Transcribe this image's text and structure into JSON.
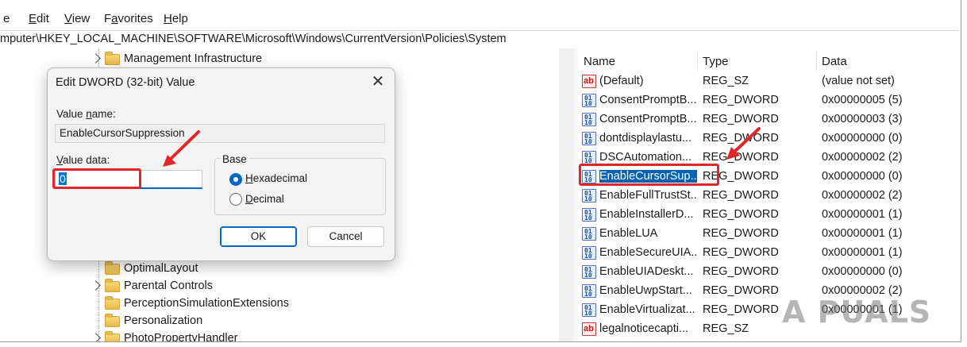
{
  "menu": {
    "items": [
      "e",
      "Edit",
      "View",
      "Favorites",
      "Help"
    ],
    "underlined": [
      "",
      "E",
      "V",
      "a",
      "H"
    ]
  },
  "address": "mputer\\HKEY_LOCAL_MACHINE\\SOFTWARE\\Microsoft\\Windows\\CurrentVersion\\Policies\\System",
  "tree": {
    "top_node": "Management Infrastructure",
    "nodes": [
      "OptimalLayout",
      "Parental Controls",
      "PerceptionSimulationExtensions",
      "Personalization",
      "PhotoPropertyHandler"
    ]
  },
  "list": {
    "columns": [
      "Name",
      "Type",
      "Data"
    ],
    "rows": [
      {
        "icon": "string-value-icon",
        "name": "(Default)",
        "type": "REG_SZ",
        "data": "(value not set)"
      },
      {
        "icon": "dword-value-icon",
        "name": "ConsentPromptB...",
        "type": "REG_DWORD",
        "data": "0x00000005 (5)"
      },
      {
        "icon": "dword-value-icon",
        "name": "ConsentPromptB...",
        "type": "REG_DWORD",
        "data": "0x00000003 (3)"
      },
      {
        "icon": "dword-value-icon",
        "name": "dontdisplaylastu...",
        "type": "REG_DWORD",
        "data": "0x00000000 (0)"
      },
      {
        "icon": "dword-value-icon",
        "name": "DSCAutomation...",
        "type": "REG_DWORD",
        "data": "0x00000002 (2)"
      },
      {
        "icon": "dword-value-icon",
        "name": "EnableCursorSup...",
        "type": "REG_DWORD",
        "data": "0x00000000 (0)",
        "selected": true
      },
      {
        "icon": "dword-value-icon",
        "name": "EnableFullTrustSt...",
        "type": "REG_DWORD",
        "data": "0x00000002 (2)"
      },
      {
        "icon": "dword-value-icon",
        "name": "EnableInstallerD...",
        "type": "REG_DWORD",
        "data": "0x00000001 (1)"
      },
      {
        "icon": "dword-value-icon",
        "name": "EnableLUA",
        "type": "REG_DWORD",
        "data": "0x00000001 (1)"
      },
      {
        "icon": "dword-value-icon",
        "name": "EnableSecureUIA...",
        "type": "REG_DWORD",
        "data": "0x00000001 (1)"
      },
      {
        "icon": "dword-value-icon",
        "name": "EnableUIADeskt...",
        "type": "REG_DWORD",
        "data": "0x00000000 (0)"
      },
      {
        "icon": "dword-value-icon",
        "name": "EnableUwpStart...",
        "type": "REG_DWORD",
        "data": "0x00000002 (2)"
      },
      {
        "icon": "dword-value-icon",
        "name": "EnableVirtualizat...",
        "type": "REG_DWORD",
        "data": "0x00000001 (1)"
      },
      {
        "icon": "string-value-icon",
        "name": "legalnoticecapti...",
        "type": "REG_SZ",
        "data": ""
      }
    ]
  },
  "dialog": {
    "title": "Edit DWORD (32-bit) Value",
    "value_name_label": "Value name:",
    "value_name": "EnableCursorSuppression",
    "value_data_label": "Value data:",
    "value_data": "0",
    "base_label": "Base",
    "hex_label": "Hexadecimal",
    "dec_label": "Decimal",
    "base_selected": "Hexadecimal",
    "ok": "OK",
    "cancel": "Cancel",
    "close": "✕"
  },
  "icons": {
    "dword": "01\n10",
    "sz": "ab"
  },
  "watermark": "A PUALS",
  "colors": {
    "highlight": "#e0262b",
    "selection": "#0063b1",
    "accent": "#0067c0"
  }
}
